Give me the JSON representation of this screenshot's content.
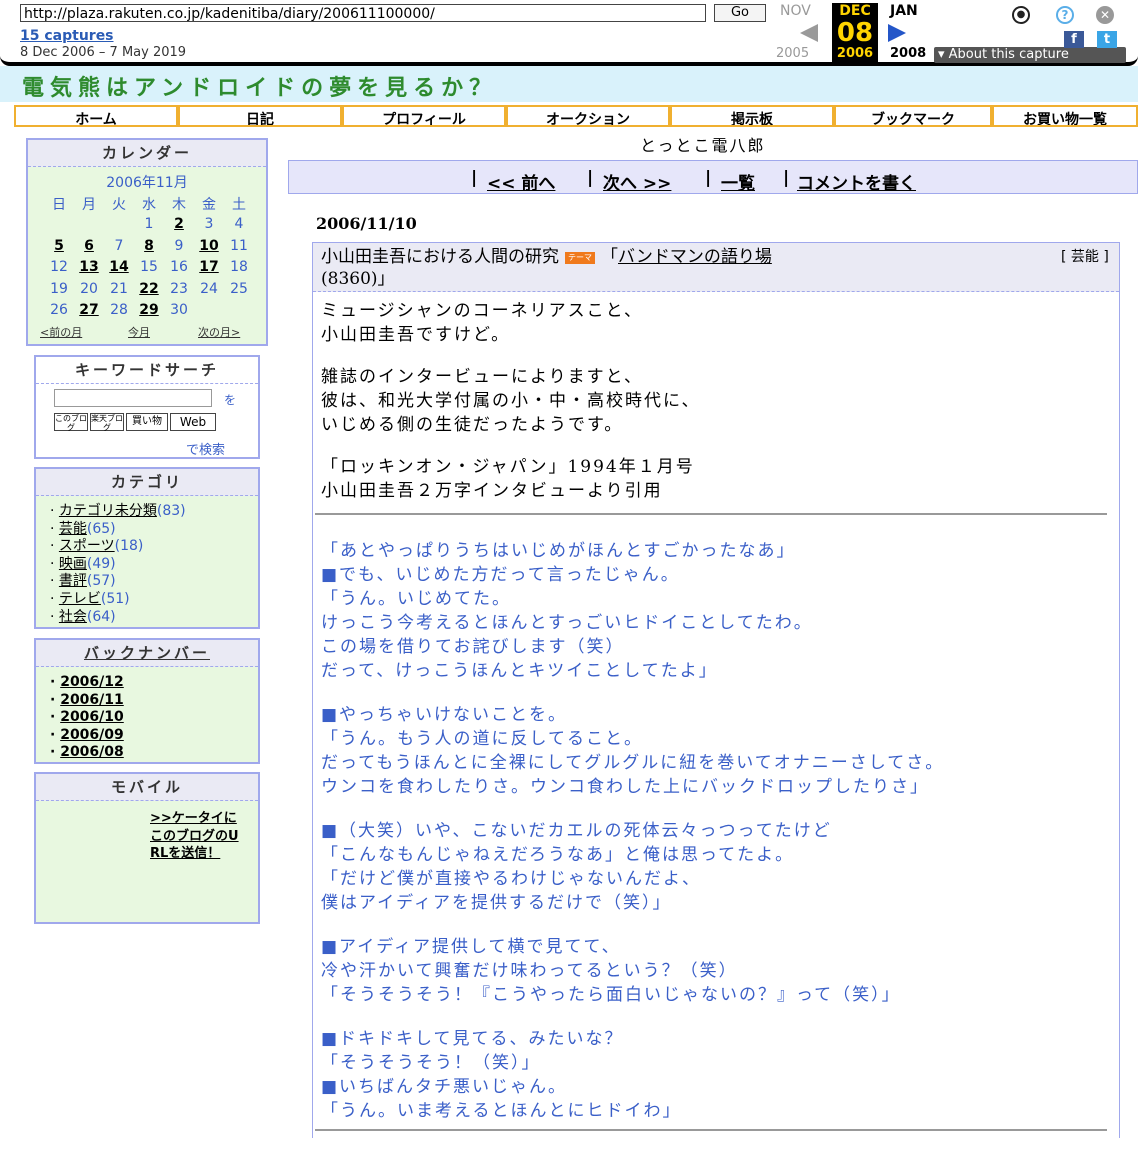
{
  "wayback": {
    "url": "http://plaza.rakuten.co.jp/kadenitiba/diary/200611100000/",
    "go_label": "Go",
    "captures": "15 captures",
    "date_range": "8 Dec 2006 – 7 May 2019",
    "prev_month": "NOV",
    "cur_month": "DEC",
    "next_month": "JAN",
    "cur_day": "08",
    "prev_year": "2005",
    "cur_year": "2006",
    "next_year": "2008",
    "about": "▾ About this capture"
  },
  "site": {
    "title": "電気熊はアンドロイドの夢を見るか？",
    "nav": [
      "ホーム",
      "日記",
      "プロフィール",
      "オークション",
      "掲示板",
      "ブックマーク",
      "お買い物一覧"
    ]
  },
  "calendar": {
    "heading": "カレンダー",
    "month": "2006年11月",
    "weekdays": [
      "日",
      "月",
      "火",
      "水",
      "木",
      "金",
      "土"
    ],
    "linked_days": [
      2,
      5,
      6,
      8,
      10,
      13,
      14,
      17,
      22,
      27,
      29
    ],
    "days_in_month": 30,
    "first_weekday": 3,
    "prev": "<前の月",
    "today": "今月",
    "next": "次の月>"
  },
  "search": {
    "heading": "キーワードサーチ",
    "wo": "を",
    "buttons": [
      "このブログ",
      "楽天ブログ",
      "買い物",
      "Web"
    ],
    "submit": "で検索"
  },
  "categories": {
    "heading": "カテゴリ",
    "items": [
      {
        "label": "カテゴリ未分類",
        "count": "(83)"
      },
      {
        "label": "芸能",
        "count": "(65)"
      },
      {
        "label": "スポーツ",
        "count": "(18)"
      },
      {
        "label": "映画",
        "count": "(49)"
      },
      {
        "label": "書評",
        "count": "(57)"
      },
      {
        "label": "テレビ",
        "count": "(51)"
      },
      {
        "label": "社会",
        "count": "(64)"
      }
    ]
  },
  "backnumber": {
    "heading": "バックナンバー",
    "items": [
      "2006/12",
      "2006/11",
      "2006/10",
      "2006/09",
      "2006/08"
    ]
  },
  "mobile": {
    "heading": "モバイル",
    "link": ">>ケータイにこのブログのURLを送信！"
  },
  "main": {
    "author": "とっとこ電八郎",
    "pager": {
      "prev": "<< 前へ",
      "next": "次へ >>",
      "list": "一覧",
      "comment": "コメントを書く"
    },
    "date": "2006/11/10",
    "title": "小山田圭吾における人間の研究",
    "theme_badge": "テーマ",
    "theme_open": "「",
    "theme_link": "バンドマンの語り場",
    "theme_close": "(8360)」",
    "category": "[ 芸能 ]",
    "intro": [
      "ミュージシャンのコーネリアスこと、\n小山田圭吾ですけど。",
      "雑誌のインタービューによりますと、\n彼は、和光大学付属の小・中・高校時代に、\nいじめる側の生徒だったようです。",
      "「ロッキンオン・ジャパン」1994年１月号\n小山田圭吾２万字インタビューより引用"
    ],
    "quotes": [
      "「あとやっぱりうちはいじめがほんとすごかったなあ」\n■でも、いじめた方だって言ったじゃん。\n「うん。いじめてた。\nけっこう今考えるとほんとすっごいヒドイことしてたわ。\nこの場を借りてお詫びします（笑）\nだって、けっこうほんとキツイことしてたよ」",
      "■やっちゃいけないことを。\n「うん。もう人の道に反してること。\nだってもうほんとに全裸にしてグルグルに紐を巻いてオナニーさしてさ。\nウンコを食わしたりさ。ウンコ食わした上にバックドロップしたりさ」",
      "■（大笑）いや、こないだカエルの死体云々っつってたけど\n「こんなもんじゃねえだろうなあ」と俺は思ってたよ。\n「だけど僕が直接やるわけじゃないんだよ、\n僕はアイディアを提供するだけで（笑）」",
      "■アイディア提供して横で見てて、\n冷や汗かいて興奮だけ味わってるという？（笑）\n「そうそうそう！『こうやったら面白いじゃないの？』って（笑）」",
      "■ドキドキして見てる、みたいな？\n「そうそうそう！（笑）」\n■いちばんタチ悪いじゃん。\n「うん。いま考えるとほんとにヒドイわ」"
    ]
  }
}
